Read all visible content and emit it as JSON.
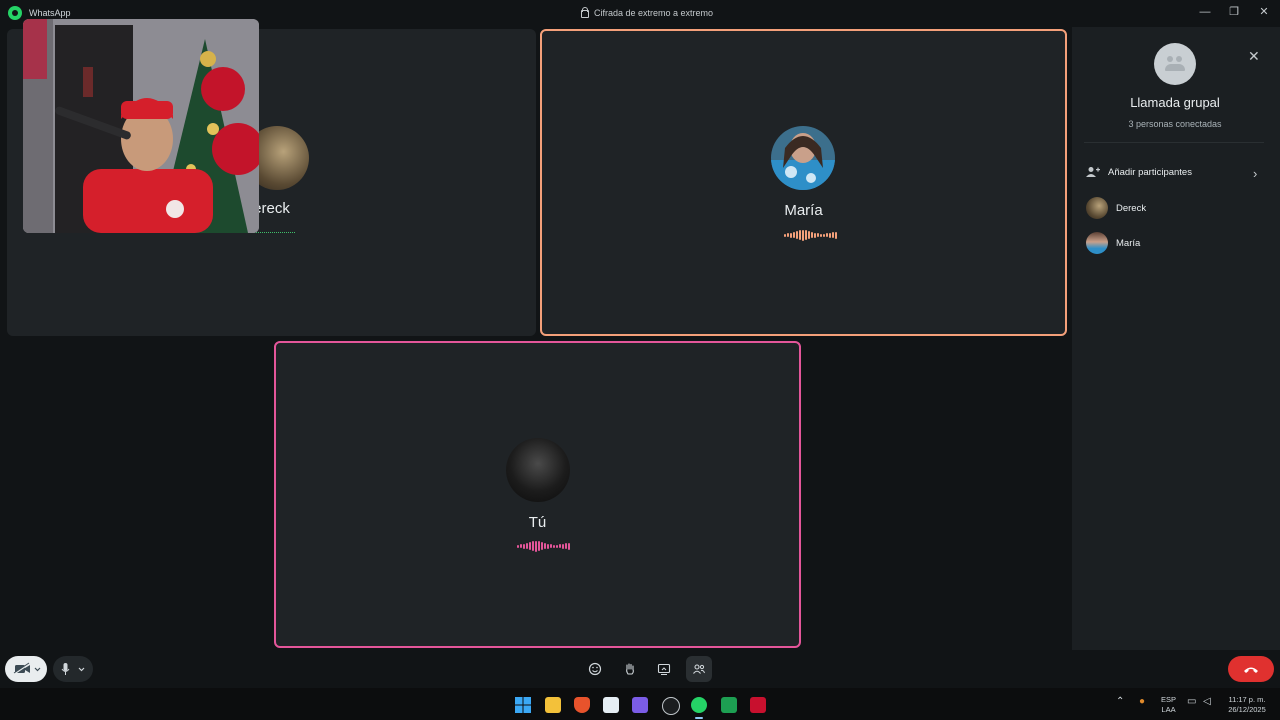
{
  "titlebar": {
    "app_name": "WhatsApp",
    "encryption_label": "Cifrada de extremo a extremo",
    "minimize": "—",
    "maximize": "❐",
    "close": "✕"
  },
  "tiles": [
    {
      "name": "Dereck",
      "visible_label": "ereck",
      "active": false
    },
    {
      "name": "María",
      "active": true,
      "border_color": "#f4a07a"
    },
    {
      "name": "Tú",
      "active": true,
      "border_color": "#e4569a"
    }
  ],
  "panel": {
    "title": "Llamada grupal",
    "subtitle": "3 personas conectadas",
    "close": "✕",
    "add_participants": "Añadir participantes",
    "chevron": "›",
    "participants": [
      "Dereck",
      "María"
    ]
  },
  "callbar": {
    "camera_icon": "video-off-icon",
    "mic_icon": "microphone-icon",
    "emoji_icon": "emoji-icon",
    "raise_hand_icon": "raise-hand-icon",
    "share_screen_icon": "share-screen-icon",
    "participants_icon": "participants-icon",
    "end_call_icon": "phone-hangup-icon",
    "end_call_color": "#e0312f"
  },
  "taskbar": {
    "lang_top": "ESP",
    "lang_bottom": "LAA",
    "time": "11:17 p. m.",
    "date": "26/12/2025"
  },
  "colors": {
    "accent_whatsapp": "#25d366",
    "maria_wave": "#f4a07a",
    "tu_wave": "#e4569a",
    "dereck_wave": "#3fbf6a"
  }
}
